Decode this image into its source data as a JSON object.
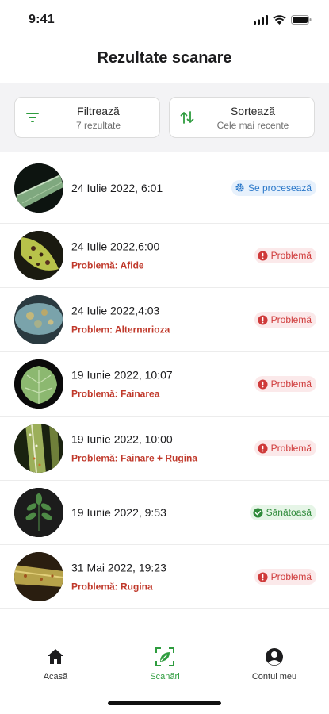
{
  "status_bar": {
    "time": "9:41"
  },
  "title": "Rezultate scanare",
  "filter": {
    "label": "Filtrează",
    "sub": "7 rezultate"
  },
  "sort": {
    "label": "Sortează",
    "sub": "Cele mai recente"
  },
  "scans": [
    {
      "date": "24 Iulie 2022, 6:01",
      "problem": "",
      "status": "Se procesează",
      "status_type": "processing",
      "thumb": "pale-leaf"
    },
    {
      "date": "24 Iulie 2022,6:00",
      "problem": "Problemă: Afide",
      "status": "Problemă",
      "status_type": "problem",
      "thumb": "aphid-leaf"
    },
    {
      "date": "24 Iulie 2022,4:03",
      "problem": "Problem: Alternarioza",
      "status": "Problemă",
      "status_type": "problem",
      "thumb": "spotted-leaf"
    },
    {
      "date": "19 Iunie 2022, 10:07",
      "problem": "Problemă: Fainarea",
      "status": "Problemă",
      "status_type": "problem",
      "thumb": "round-leaf"
    },
    {
      "date": "19 Iunie 2022, 10:00",
      "problem": "Problemă: Fainare + Rugina",
      "status": "Problemă",
      "status_type": "problem",
      "thumb": "striped-leaf"
    },
    {
      "date": "19 Iunie 2022, 9:53",
      "problem": "",
      "status": "Sănătoasă",
      "status_type": "healthy",
      "thumb": "compound-leaf"
    },
    {
      "date": "31 Mai 2022, 19:23",
      "problem": "Problemă: Rugina",
      "status": "Problemă",
      "status_type": "problem",
      "thumb": "rust-leaf"
    }
  ],
  "tabs": [
    {
      "label": "Acasă",
      "icon": "home-icon"
    },
    {
      "label": "Scanări",
      "icon": "scan-leaf-icon",
      "active": true
    },
    {
      "label": "Contul meu",
      "icon": "account-icon"
    }
  ],
  "colors": {
    "accent_green": "#2e9c3e",
    "problem_red": "#cf3a3a",
    "processing_blue": "#2a78c9"
  }
}
